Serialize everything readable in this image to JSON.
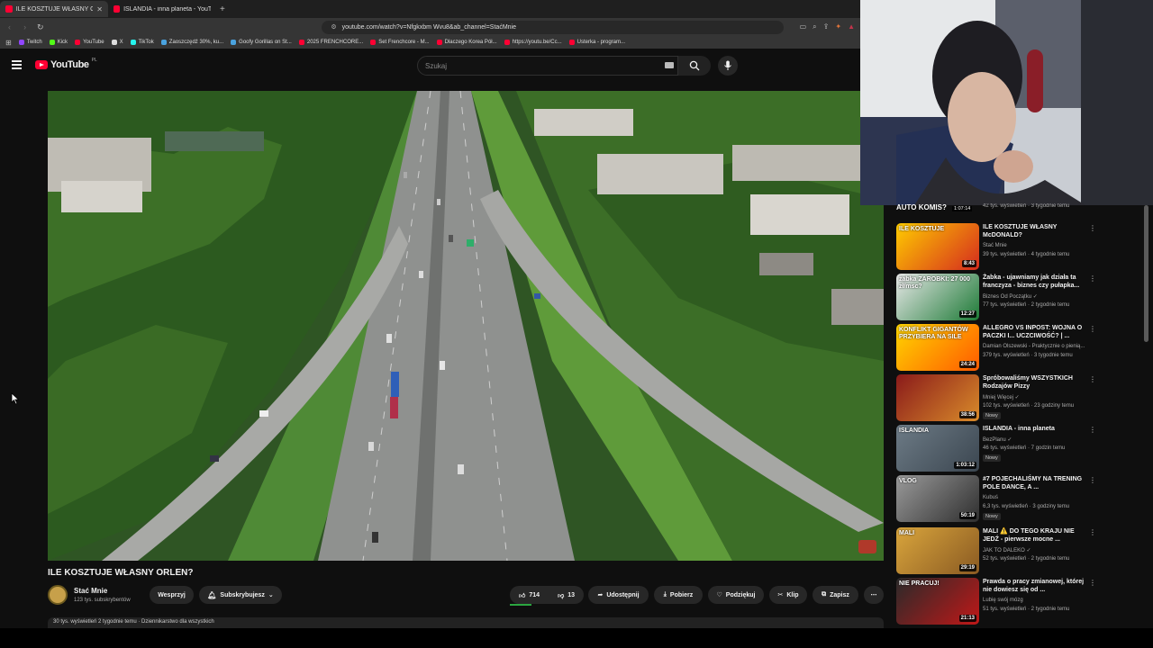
{
  "browser": {
    "tabs": [
      {
        "label": "ILE KOSZTUJE WŁASNY ORLEN",
        "active": true
      },
      {
        "label": "ISLANDIA - inna planeta - YouTube",
        "active": false
      }
    ],
    "url": "youtube.com/watch?v=Nfgkxbm Wvu8&ab_channel=StaćMnie",
    "bookmarks": [
      "Twitch",
      "Kick",
      "YouTube",
      "X",
      "TikTok",
      "Zaoszczędź 30%, ku...",
      "Goofy Gorillas on St...",
      "2025 FRENCHCORE...",
      "Set Frenchcore - M...",
      "Dlaczego Korea Pół...",
      "https://youtu.be/Cc...",
      "Usterka - program..."
    ]
  },
  "header": {
    "logo": "YouTube",
    "logo_region": "PL",
    "search_placeholder": "Szukaj"
  },
  "video": {
    "title": "ILE KOSZTUJE WŁASNY ORLEN?",
    "channel": "Stać Mnie",
    "subscribers": "123 tys. subskrybentów",
    "support_label": "Wesprzyj",
    "subscribed_label": "Subskrybujesz",
    "likes": "714",
    "dislikes": "13",
    "like_ratio": 0.98,
    "share_label": "Udostępnij",
    "download_label": "Pobierz",
    "thanks_label": "Podziękuj",
    "clip_label": "Klip",
    "save_label": "Zapisz",
    "description_peek": "30 tys. wyświetleń  2 tygodnie temu  · Dziennikarstwo dla wszystkich"
  },
  "sidebar": {
    "top_partial": "42 tys. wyświetleń · 3 tygodnie temu",
    "top_partial_overlay": "AUTO KOMIS?",
    "top_partial_duration": "1:07:14",
    "items": [
      {
        "title": "ILE KOSZTUJE WŁASNY McDONALD?",
        "channel": "Stać Mnie",
        "meta": "39 tys. wyświetleń · 4 tygodnie temu",
        "duration": "8:43",
        "badge": "",
        "thumb_text": "ILE KOSZTUJE",
        "colors": [
          "#ffcc00",
          "#d52b1e"
        ]
      },
      {
        "title": "Żabka - ujawniamy jak działa ta franczyza - biznes czy pułapka...",
        "channel": "Biznes Od Początku ✓",
        "meta": "77 tys. wyświetleń · 2 tygodnie temu",
        "duration": "12:27",
        "badge": "",
        "thumb_text": "żabka ZAROBKI: 27 000 zł/msc?",
        "colors": [
          "#e8e8e8",
          "#1d7a36"
        ]
      },
      {
        "title": "ALLEGRO VS INPOST: WOJNA O PACZKI I... UCZCIWOŚĆ? | ...",
        "channel": "Damian Olszewski - Praktycznie o pienią...",
        "meta": "379 tys. wyświetleń · 3 tygodnie temu",
        "duration": "24:24",
        "badge": "",
        "thumb_text": "KONFLIKT GIGANTÓW PRZYBIERA NA SILE",
        "colors": [
          "#ffd500",
          "#ff5a00"
        ]
      },
      {
        "title": "Spróbowaliśmy WSZYSTKICH Rodzajów Pizzy",
        "channel": "Mniej Więcej ✓",
        "meta": "102 tys. wyświetleń · 23 godziny temu",
        "duration": "38:56",
        "badge": "Nowy",
        "thumb_text": "",
        "colors": [
          "#8a1a1a",
          "#d98b2a"
        ]
      },
      {
        "title": "ISLANDIA - inna planeta",
        "channel": "BezPlanu ✓",
        "meta": "46 tys. wyświetleń · 7 godzin temu",
        "duration": "1:03:12",
        "badge": "Nowy",
        "thumb_text": "ISLANDIA",
        "colors": [
          "#6d7b86",
          "#3b4650"
        ]
      },
      {
        "title": "#7 POJECHALIŚMY NA TRENING POLE DANCE, A ...",
        "channel": "Kubuś",
        "meta": "6,3 tys. wyświetleń · 3 godziny temu",
        "duration": "50:19",
        "badge": "Nowy",
        "thumb_text": "VLOG",
        "colors": [
          "#9a9a9a",
          "#2e2e2e"
        ]
      },
      {
        "title": "MALI ⚠️ DO TEGO KRAJU NIE JEDŹ - pierwsze mocne ...",
        "channel": "JAK TO DALEKO ✓",
        "meta": "52 tys. wyświetleń · 2 tygodnie temu",
        "duration": "29:19",
        "badge": "",
        "thumb_text": "MALI",
        "colors": [
          "#d9a53c",
          "#8a5a22"
        ]
      },
      {
        "title": "Prawda o pracy zmianowej, której nie dowiesz się od ...",
        "channel": "Lubię swój mózg",
        "meta": "51 tys. wyświetleń · 2 tygodnie temu",
        "duration": "21:13",
        "badge": "",
        "thumb_text": "NIE PRACUJ!",
        "colors": [
          "#2a2a2a",
          "#c01818"
        ]
      }
    ]
  },
  "colors": {
    "background": "#0f0f0f",
    "yt_red": "#ff0033",
    "pill": "#272727",
    "secondary_text": "#aaaaaa",
    "like_bar": "#2ba640"
  }
}
